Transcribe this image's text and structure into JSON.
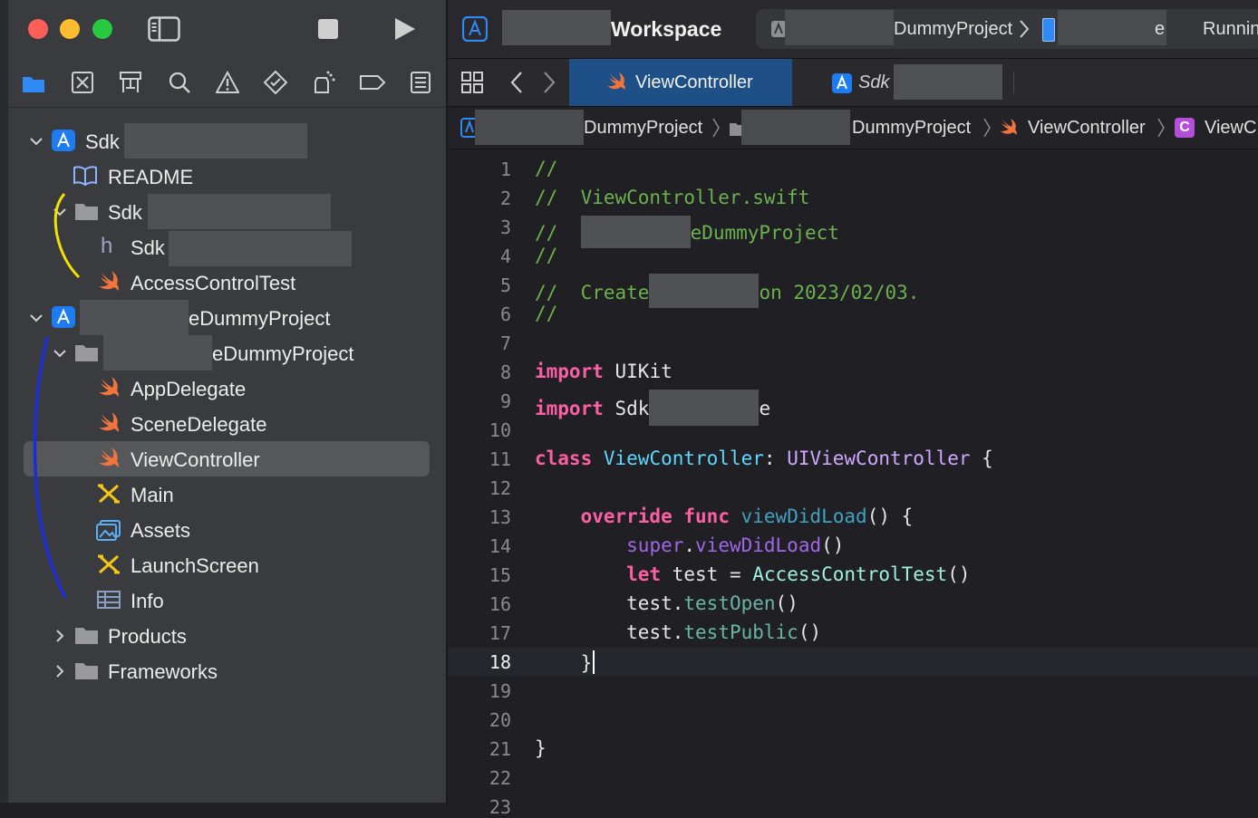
{
  "workspace": {
    "title": "Workspace",
    "scheme_project": "DummyProject",
    "device": "e",
    "status": "Runnin"
  },
  "navigator_tools": [
    "folder-icon",
    "source-control-icon",
    "symbol-icon",
    "search-icon",
    "warning-icon",
    "test-icon",
    "debug-icon",
    "breakpoint-icon",
    "report-icon"
  ],
  "tree": {
    "sdk_project_label": "Sdk",
    "readme": "README",
    "sdk_folder_label": "Sdk",
    "sdk_header_label": "Sdk",
    "access_control_test": "AccessControlTest",
    "dummy_project": "eDummyProject",
    "dummy_folder": "eDummyProject",
    "app_delegate": "AppDelegate",
    "scene_delegate": "SceneDelegate",
    "view_controller": "ViewController",
    "main": "Main",
    "assets": "Assets",
    "launch_screen": "LaunchScreen",
    "info": "Info",
    "products": "Products",
    "frameworks": "Frameworks"
  },
  "tabs": {
    "active": "ViewController",
    "second": "Sdk"
  },
  "jumpbar": {
    "project": "DummyProject",
    "folder": "DummyProject",
    "file": "ViewController",
    "symbol": "ViewC"
  },
  "code": {
    "line_numbers": [
      "1",
      "2",
      "3",
      "4",
      "5",
      "6",
      "7",
      "8",
      "9",
      "10",
      "11",
      "12",
      "13",
      "14",
      "15",
      "16",
      "17",
      "18",
      "19",
      "20",
      "21",
      "22",
      "23"
    ],
    "l1": "//",
    "l2": "//  ViewController.swift",
    "l3a": "//  ",
    "l3b": "eDummyProject",
    "l4": "//",
    "l5a": "//  Create",
    "l5b": "on 2023/02/03.",
    "l6": "//",
    "import": "import",
    "uikit": "UIKit",
    "sdk": "Sdk",
    "sdk_end": "e",
    "class": "class",
    "vc": "ViewController",
    "colon": ":",
    "uivc": "UIViewController",
    "brace_open": "{",
    "override": "override",
    "func": "func",
    "vdl": "viewDidLoad",
    "parens_brace": "() {",
    "super": "super",
    "dot": ".",
    "vdl2": "viewDidLoad",
    "parens": "()",
    "let": "let",
    "test_eq": "test =",
    "act": "AccessControlTest",
    "test": "test",
    "test_open": "testOpen",
    "test_public": "testPublic",
    "close_brace": "}"
  },
  "colors": {
    "accent": "#0a84ff",
    "swift": "#f0743c",
    "selection": "#56575a"
  }
}
